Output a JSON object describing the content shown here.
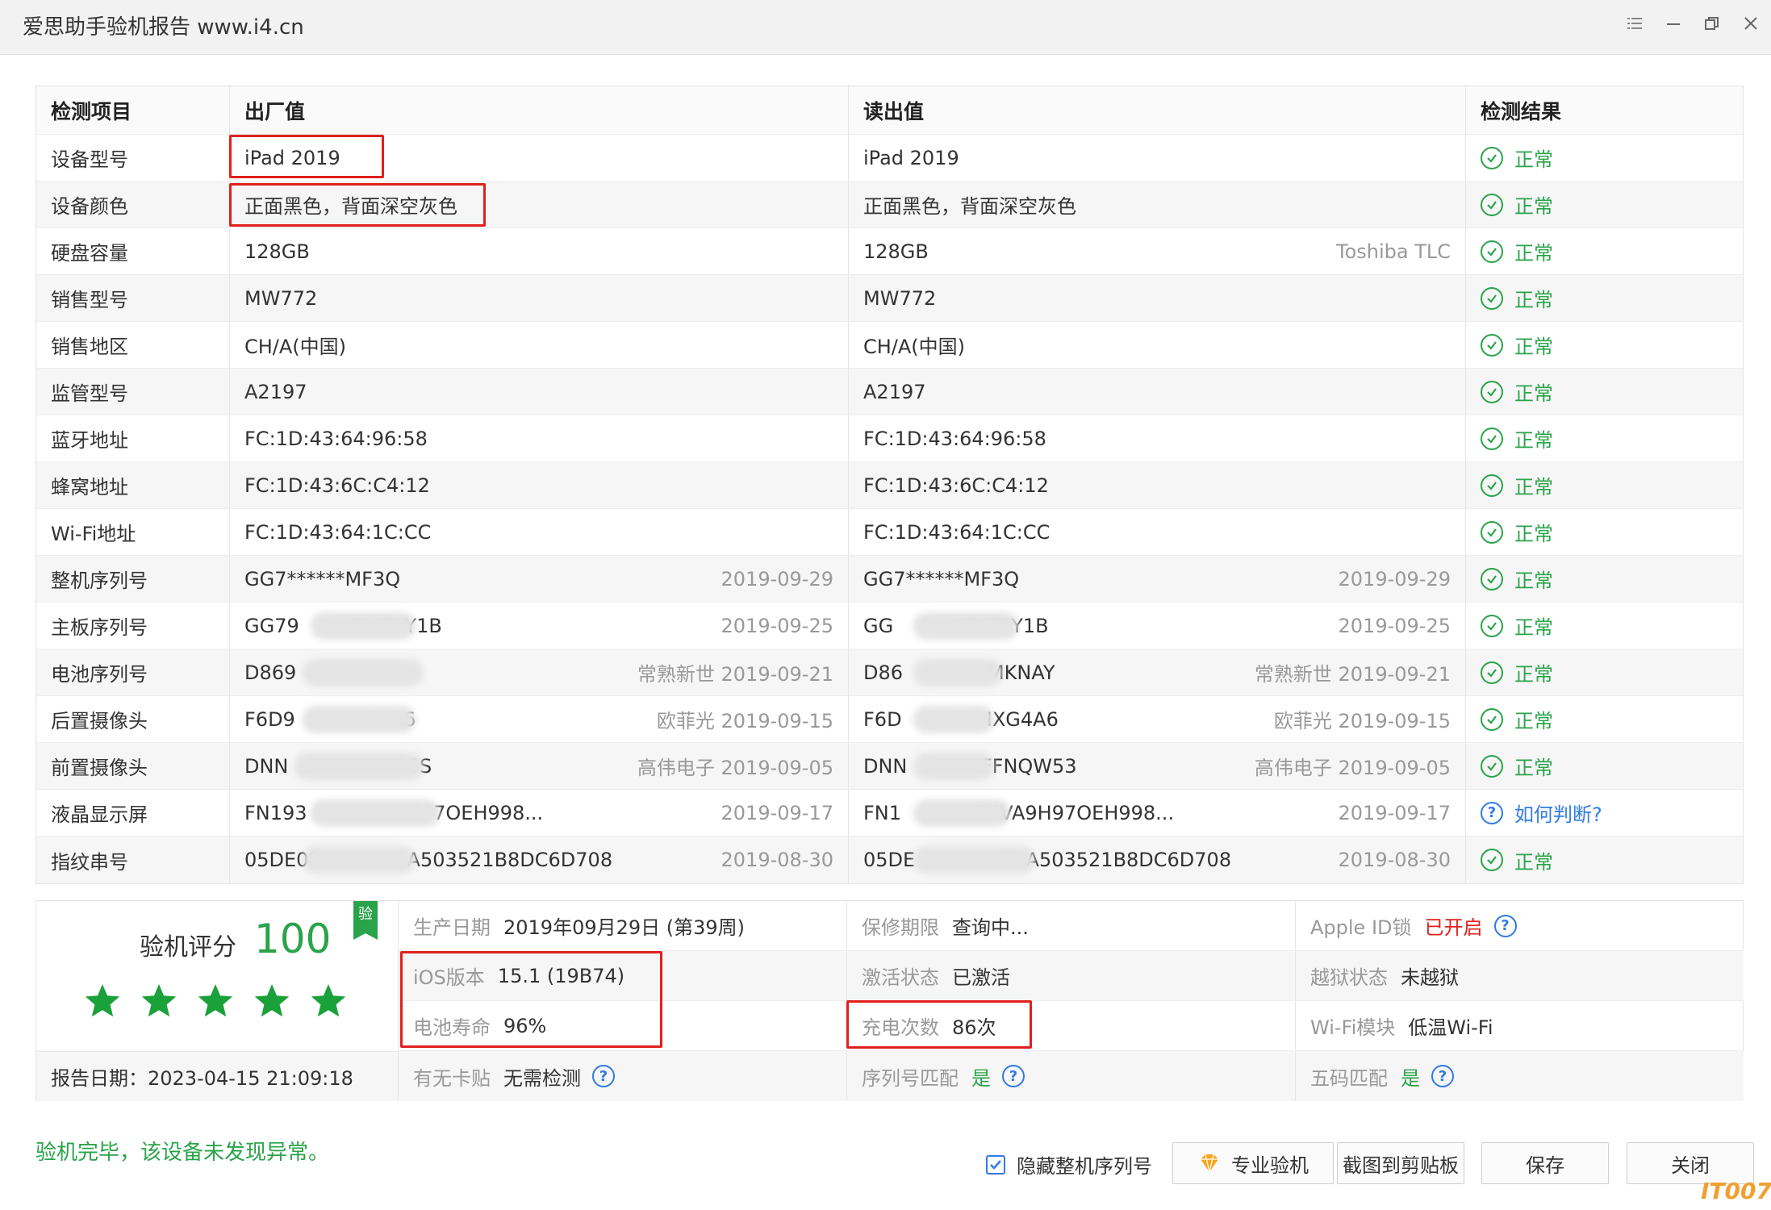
{
  "window": {
    "title": "爱思助手验机报告 www.i4.cn"
  },
  "table": {
    "headers": [
      "检测项目",
      "出厂值",
      "读出值",
      "检测结果"
    ],
    "rows": [
      {
        "item": "设备型号",
        "factory": "iPad 2019",
        "factory_note": "",
        "read": "iPad 2019",
        "read_note": "",
        "result": "正常"
      },
      {
        "item": "设备颜色",
        "factory": "正面黑色，背面深空灰色",
        "factory_note": "",
        "read": "正面黑色，背面深空灰色",
        "read_note": "",
        "result": "正常"
      },
      {
        "item": "硬盘容量",
        "factory": "128GB",
        "factory_note": "",
        "read": "128GB",
        "read_note": "Toshiba TLC",
        "result": "正常"
      },
      {
        "item": "销售型号",
        "factory": "MW772",
        "factory_note": "",
        "read": "MW772",
        "read_note": "",
        "result": "正常"
      },
      {
        "item": "销售地区",
        "factory": "CH/A(中国)",
        "factory_note": "",
        "read": "CH/A(中国)",
        "read_note": "",
        "result": "正常"
      },
      {
        "item": "监管型号",
        "factory": "A2197",
        "factory_note": "",
        "read": "A2197",
        "read_note": "",
        "result": "正常"
      },
      {
        "item": "蓝牙地址",
        "factory": "FC:1D:43:64:96:58",
        "factory_note": "",
        "read": "FC:1D:43:64:96:58",
        "read_note": "",
        "result": "正常"
      },
      {
        "item": "蜂窝地址",
        "factory": "FC:1D:43:6C:C4:12",
        "factory_note": "",
        "read": "FC:1D:43:6C:C4:12",
        "read_note": "",
        "result": "正常"
      },
      {
        "item": "Wi-Fi地址",
        "factory": "FC:1D:43:64:1C:CC",
        "factory_note": "",
        "read": "FC:1D:43:64:1C:CC",
        "read_note": "",
        "result": "正常"
      },
      {
        "item": "整机序列号",
        "factory": "GG7******MF3Q",
        "factory_note": "2019-09-29",
        "read": "GG7******MF3Q",
        "read_note": "2019-09-29",
        "result": "正常"
      },
      {
        "item": "主板序列号",
        "factory": "GG79        P0LT8Y1B",
        "factory_note": "2019-09-25",
        "read": "GG          P0LT8Y1B",
        "read_note": "2019-09-25",
        "result": "正常"
      },
      {
        "item": "电池序列号",
        "factory": "D869          KNAY",
        "factory_note": "常熟新世 2019-09-21",
        "read": "D86          8LMKNAY",
        "read_note": "常熟新世 2019-09-21",
        "result": "正常"
      },
      {
        "item": "后置摄像头",
        "factory": "F6D9           G4A6",
        "factory_note": "欧菲光 2019-09-15",
        "read": "F6D        EHHXG4A6",
        "read_note": "欧菲光 2019-09-15",
        "result": "正常"
      },
      {
        "item": "前置摄像头",
        "factory": "DNN             2DP5S",
        "factory_note": "高伟电子 2019-09-05",
        "read": "DNN          EFFNQW53",
        "read_note": "高伟电子 2019-09-05",
        "result": "正常"
      },
      {
        "item": "液晶显示屏",
        "factory": "FN193            A9H97OEH998...",
        "factory_note": "2019-09-17",
        "read": "FN1            87VA9H97OEH998...",
        "read_note": "2019-09-17",
        "result": "如何判断?"
      },
      {
        "item": "指纹串号",
        "factory": "05DE02              A503521B8DC6D708",
        "factory_note": "2019-08-30",
        "read": "05DE              69A503521B8DC6D708",
        "read_note": "2019-08-30",
        "result": "正常"
      }
    ]
  },
  "summary": {
    "score_label": "验机评分",
    "score": "100",
    "stars": 5,
    "badge": "验",
    "report_date": "报告日期：2023-04-15 21:09:18",
    "grid": [
      [
        {
          "label": "生产日期",
          "value": "2019年09月29日 (第39周)"
        },
        {
          "label": "保修期限",
          "value": "查询中..."
        },
        {
          "label": "Apple ID锁",
          "value": "已开启",
          "style": "red",
          "help": true
        }
      ],
      [
        {
          "label": "iOS版本",
          "value": "15.1 (19B74)"
        },
        {
          "label": "激活状态",
          "value": "已激活"
        },
        {
          "label": "越狱状态",
          "value": "未越狱"
        }
      ],
      [
        {
          "label": "电池寿命",
          "value": "96%"
        },
        {
          "label": "充电次数",
          "value": "86次"
        },
        {
          "label": "Wi-Fi模块",
          "value": "低温Wi-Fi"
        }
      ],
      [
        {
          "label": "有无卡贴",
          "value": "无需检测",
          "help": true
        },
        {
          "label": "序列号匹配",
          "value": "是",
          "style": "green",
          "help": true
        },
        {
          "label": "五码匹配",
          "value": "是",
          "style": "green",
          "help": true
        }
      ]
    ]
  },
  "footer": {
    "status": "验机完毕，该设备未发现异常。",
    "hide_serial_label": "隐藏整机序列号",
    "hide_serial_checked": true,
    "pro_button": "专业验机",
    "screenshot_button": "截图到剪贴板",
    "save_button": "保存",
    "close_button": "关闭"
  },
  "watermark": "IT007",
  "colors": {
    "green": "#2aa34a",
    "blue": "#2f7be5",
    "red": "#e0201d"
  },
  "icons": {
    "menu": "list-icon",
    "minimize": "minimize-icon",
    "restore": "restore-icon",
    "close": "close-icon",
    "ok": "check-circle-icon",
    "help": "question-circle-icon",
    "star": "star-icon",
    "pro": "diamond-icon"
  }
}
